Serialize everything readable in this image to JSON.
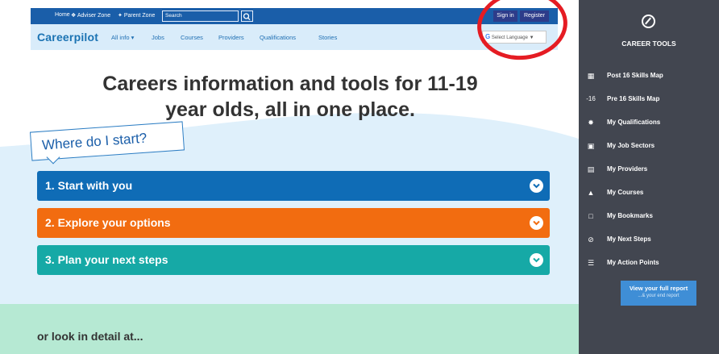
{
  "topbar": {
    "home": "Home",
    "adviser_zone": "Adviser Zone",
    "parent_zone": "Parent Zone",
    "search_placeholder": "Search",
    "sign_in": "Sign in",
    "register": "Register"
  },
  "nav": {
    "logo": "Careerpilot",
    "items": [
      "All info ▾",
      "Jobs",
      "Courses",
      "Providers",
      "Qualifications",
      "Stories"
    ],
    "language": "Select Language"
  },
  "hero": {
    "headline_line1": "Careers information and tools for 11-19",
    "headline_line2": "year olds, all in one place.",
    "bubble": "Where do I start?",
    "accordions": [
      {
        "label": "1. Start with you",
        "color": "#0f6cb6"
      },
      {
        "label": "2. Explore your options",
        "color": "#f26c10"
      },
      {
        "label": "3. Plan your next steps",
        "color": "#16a9a6"
      }
    ]
  },
  "lower": {
    "text": "or look in detail at..."
  },
  "sidebar": {
    "title": "CAREER TOOLS",
    "items": [
      {
        "icon": "map-icon",
        "label": "Post 16 Skills Map"
      },
      {
        "icon": "pre16-icon",
        "label": "Pre 16 Skills Map"
      },
      {
        "icon": "badge-icon",
        "label": "My Qualifications"
      },
      {
        "icon": "briefcase-icon",
        "label": "My Job Sectors"
      },
      {
        "icon": "institution-icon",
        "label": "My Providers"
      },
      {
        "icon": "graduation-cap-icon",
        "label": "My Courses"
      },
      {
        "icon": "bookmark-icon",
        "label": "My Bookmarks"
      },
      {
        "icon": "compass-icon",
        "label": "My Next Steps"
      },
      {
        "icon": "list-icon",
        "label": "My Action Points"
      }
    ],
    "report_line1": "View your full report",
    "report_line2": "...& your end report"
  },
  "colors": {
    "topbar": "#1a5ea9",
    "nav_bg": "#d9ecfa",
    "sidebar_bg": "#424650",
    "annotation": "#e51c23"
  }
}
